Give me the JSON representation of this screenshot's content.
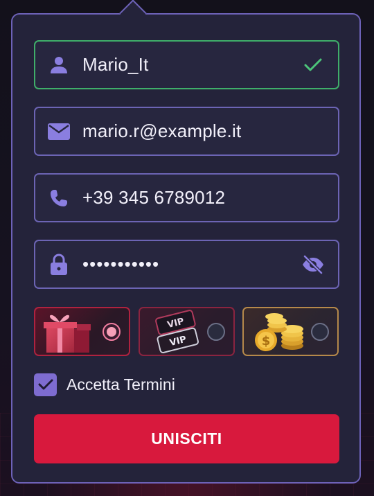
{
  "form": {
    "username": {
      "value": "Mario_It",
      "icon": "user-icon",
      "status": "valid",
      "status_icon": "check-icon"
    },
    "email": {
      "value": "mario.r@example.it",
      "icon": "envelope-icon"
    },
    "phone": {
      "value": "+39 345 6789012",
      "icon": "phone-icon"
    },
    "password": {
      "value": "•••••••••••",
      "icon": "lock-icon",
      "toggle_icon": "eye-slash-icon"
    }
  },
  "bonuses": [
    {
      "icon": "gift-icon",
      "selected": true
    },
    {
      "icon": "vip-cards-icon",
      "selected": false
    },
    {
      "icon": "gold-coins-icon",
      "selected": false
    }
  ],
  "terms": {
    "label": "Accetta Termini",
    "checked": true
  },
  "submit": {
    "label": "UNISCITI"
  },
  "colors": {
    "panel_border": "#6d62b8",
    "field_border": "#6c64b4",
    "valid_border": "#3fae6a",
    "accent_purple": "#7e6cd0",
    "button_red": "#d8193d"
  }
}
